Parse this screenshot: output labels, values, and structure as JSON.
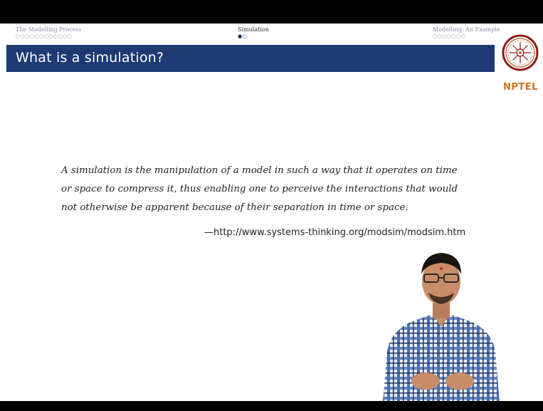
{
  "nav": {
    "sections": [
      {
        "title": "The Modelling Process",
        "dots": "○○○○○○○○○○○○"
      },
      {
        "title": "Simulation",
        "dots": "●○"
      },
      {
        "title": "Modelling: An Example",
        "dots": "○○○○○○○"
      }
    ]
  },
  "slide": {
    "title": "What is a simulation?",
    "quote": "A simulation is the manipulation of a model in such a way that it operates on time or space to compress it, thus enabling one to perceive the interactions that would not otherwise be apparent because of their separation in time or space.",
    "attribution": "—http://www.systems-thinking.org/modsim/modsim.htm"
  },
  "logo": {
    "text": "NPTEL"
  },
  "colors": {
    "title_bar": "#1d3a73",
    "logo_text": "#d0711f",
    "logo_ring": "#8b1a1a"
  }
}
